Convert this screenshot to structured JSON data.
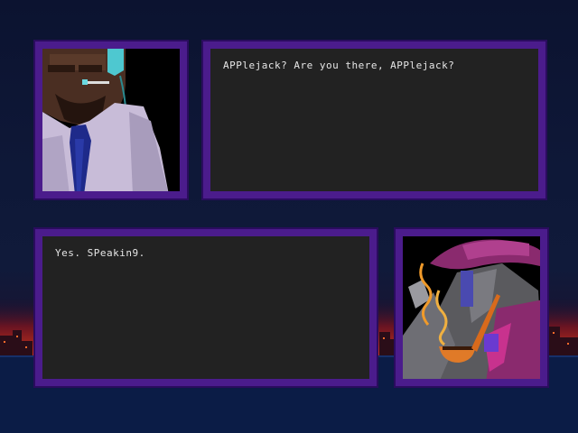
{
  "dialogue": {
    "top_line": "APPlejack? Are you there, APPlejack?",
    "bottom_line": "Yes. SPeakin9."
  },
  "portraits": {
    "top_left": "handler-with-headset",
    "bottom_right": "detective-with-pipe"
  },
  "colors": {
    "panel_border": "#4b1c8c",
    "panel_fill": "#222222",
    "text": "#e6e6e6",
    "sky": "#0c1330",
    "city_glow": "#b0281a"
  }
}
